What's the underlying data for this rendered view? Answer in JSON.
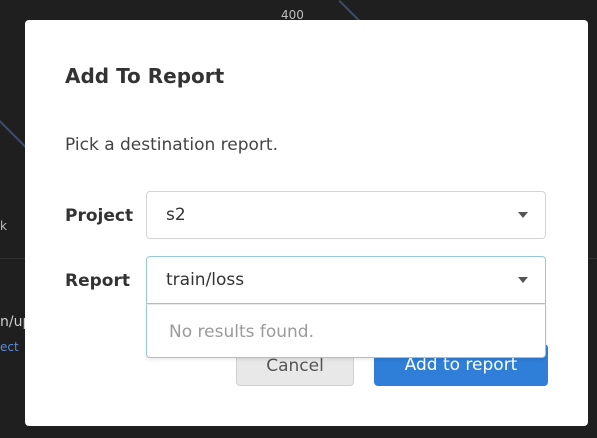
{
  "background": {
    "axis_tick": "400",
    "left_label_1": "n/up",
    "left_link": "ect",
    "left_tick": "k"
  },
  "dialog": {
    "title": "Add To Report",
    "description": "Pick a destination report.",
    "project": {
      "label": "Project",
      "value": "s2"
    },
    "report": {
      "label": "Report",
      "value": "train/loss",
      "menu_message": "No results found."
    },
    "buttons": {
      "cancel": "Cancel",
      "add": "Add to report"
    }
  },
  "colors": {
    "primary": "#2f7ed8",
    "backdrop": "#1f1f1f",
    "focus_border": "#96c8da"
  },
  "icons": {
    "dropdown": "chevron-down-icon"
  }
}
